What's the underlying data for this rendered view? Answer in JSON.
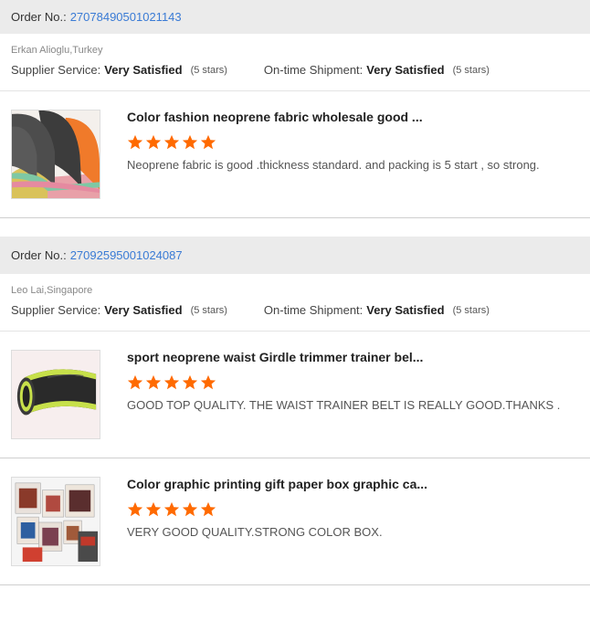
{
  "order_no_label": "Order No.:",
  "supplier_label": "Supplier Service:",
  "shipment_label": "On-time Shipment:",
  "accent_color": "#ff6a00",
  "link_color": "#3a7bd5",
  "orders": [
    {
      "order_no": "27078490501021143",
      "buyer": "Erkan Alioglu,Turkey",
      "supplier_rating": "Very Satisfied",
      "supplier_stars": "(5 stars)",
      "shipment_rating": "Very Satisfied",
      "shipment_stars": "(5 stars)",
      "products": [
        {
          "title": "Color fashion neoprene fabric wholesale good ...",
          "rating": 5,
          "review": "Neoprene fabric is good .thickness standard. and packing is 5 start , so strong.",
          "image_icon": "neoprene-fabric-rolls"
        }
      ]
    },
    {
      "order_no": "27092595001024087",
      "buyer": "Leo Lai,Singapore",
      "supplier_rating": "Very Satisfied",
      "supplier_stars": "(5 stars)",
      "shipment_rating": "Very Satisfied",
      "shipment_stars": "(5 stars)",
      "products": [
        {
          "title": "sport neoprene waist Girdle trimmer trainer bel...",
          "rating": 5,
          "review": "GOOD TOP QUALITY. THE WAIST TRAINER BELT IS REALLY GOOD.THANKS .",
          "image_icon": "waist-trainer-belt"
        },
        {
          "title": "Color graphic printing gift paper box graphic ca...",
          "rating": 5,
          "review": "VERY GOOD QUALITY.STRONG COLOR BOX.",
          "image_icon": "printed-gift-boxes"
        }
      ]
    }
  ]
}
